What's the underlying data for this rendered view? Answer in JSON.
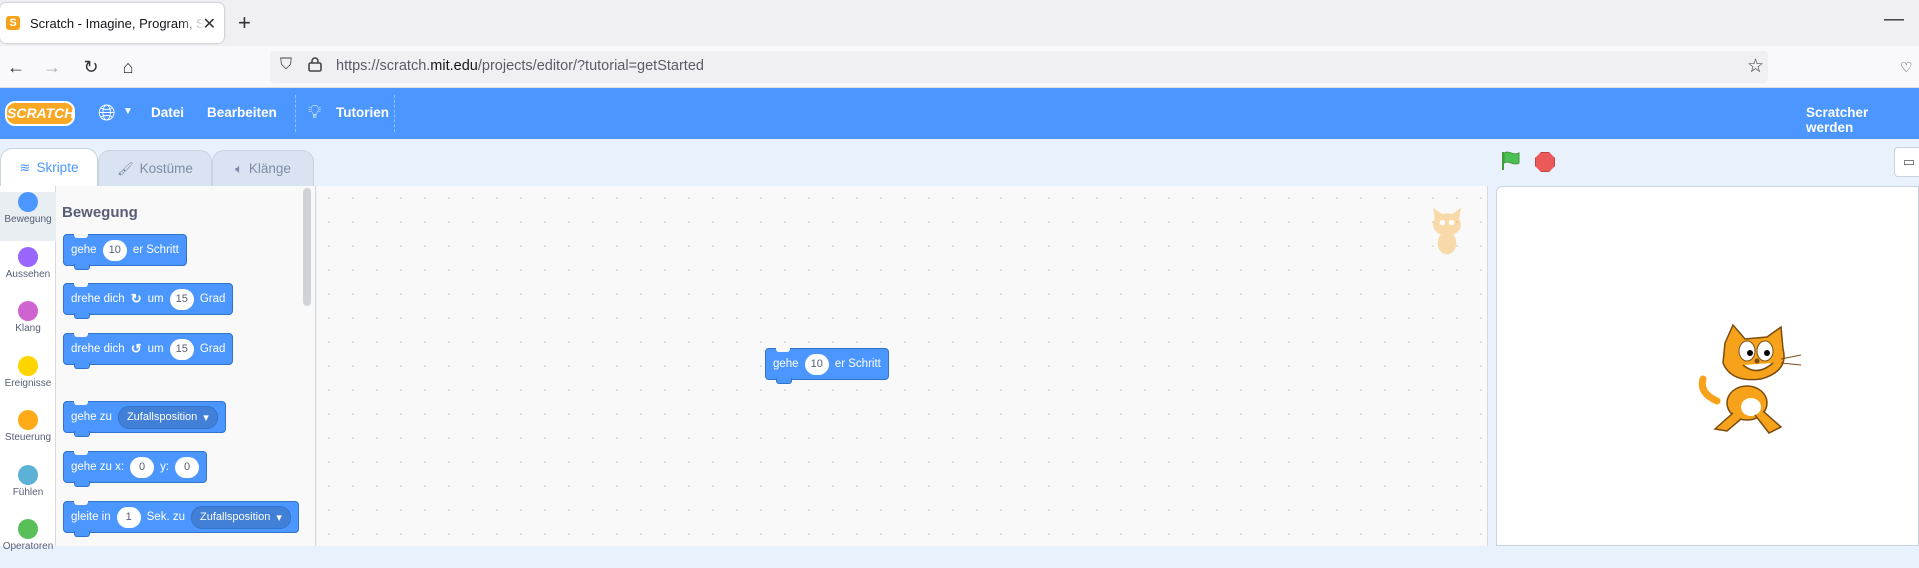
{
  "browser": {
    "tab_title": "Scratch - Imagine, Program, Share",
    "favicon": "S",
    "new_tab_icon": "+",
    "close_icon": "✕",
    "minimize_icon": "—",
    "url_prefix": "https://scratch.",
    "url_domain": "mit.edu",
    "url_suffix": "/projects/editor/?tutorial=getStarted"
  },
  "menubar": {
    "logo": "SCRATCH",
    "file": "Datei",
    "edit": "Bearbeiten",
    "tutorials": "Tutorien",
    "join": "Scratcher werden",
    "color": "#4c97ff"
  },
  "editor_tabs": {
    "code": "Skripte",
    "costumes": "Kostüme",
    "sounds": "Klänge"
  },
  "categories": [
    {
      "label": "Bewegung",
      "color": "#4c97ff"
    },
    {
      "label": "Aussehen",
      "color": "#9966ff"
    },
    {
      "label": "Klang",
      "color": "#cf63cf"
    },
    {
      "label": "Ereignisse",
      "color": "#ffd500"
    },
    {
      "label": "Steuerung",
      "color": "#ffab19"
    },
    {
      "label": "Fühlen",
      "color": "#5cb1d6"
    },
    {
      "label": "Operatoren",
      "color": "#59c059"
    }
  ],
  "flyout": {
    "title": "Bewegung",
    "blocks": {
      "move": {
        "pre": "gehe",
        "val": "10",
        "post": "er Schritt"
      },
      "turn_right": {
        "pre": "drehe dich",
        "mid": "um",
        "val": "15",
        "post": "Grad"
      },
      "turn_left": {
        "pre": "drehe dich",
        "mid": "um",
        "val": "15",
        "post": "Grad"
      },
      "goto": {
        "pre": "gehe zu",
        "dropdown": "Zufallsposition"
      },
      "goto_xy": {
        "pre": "gehe zu x:",
        "x": "0",
        "mid": "y:",
        "y": "0"
      },
      "glide": {
        "pre": "gleite in",
        "val": "1",
        "mid": "Sek. zu",
        "dropdown": "Zufallsposition"
      }
    }
  },
  "workspace": {
    "block": {
      "pre": "gehe",
      "val": "10",
      "post": "er Schritt"
    }
  }
}
